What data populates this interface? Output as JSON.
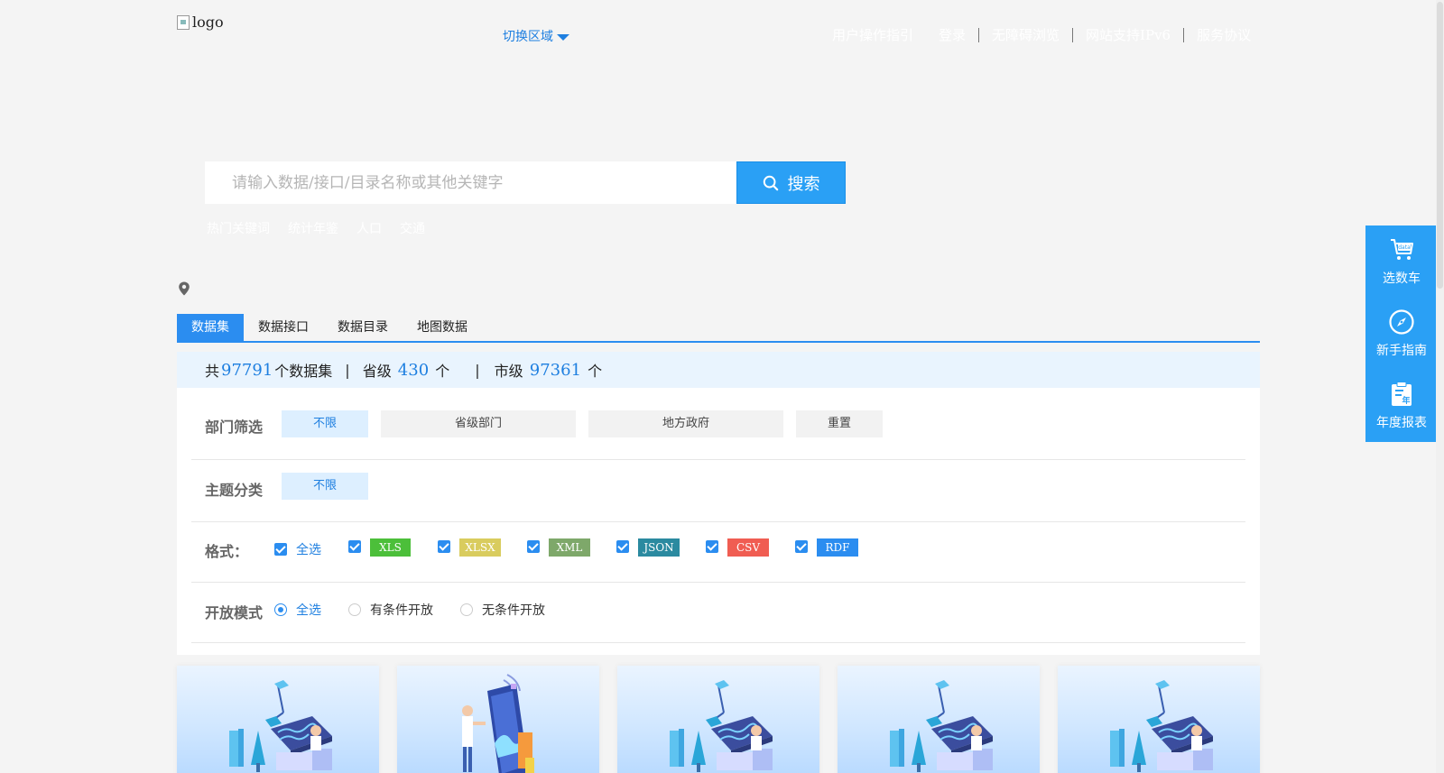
{
  "header": {
    "logo_alt": "logo",
    "region_label": "切换区域",
    "nav": [
      "用户操作指引",
      "登录",
      "无障碍浏览",
      "网站支持IPv6",
      "服务协议"
    ]
  },
  "search": {
    "placeholder": "请输入数据/接口/目录名称或其他关键字",
    "button_label": "搜索",
    "hot_words": [
      "热门关键词",
      "统计年鉴",
      "人口",
      "交通"
    ]
  },
  "tabs": [
    {
      "label": "数据集",
      "active": true
    },
    {
      "label": "数据接口",
      "active": false
    },
    {
      "label": "数据目录",
      "active": false
    },
    {
      "label": "地图数据",
      "active": false
    }
  ],
  "counts": {
    "prefix": "共",
    "total": "97791",
    "total_suffix": "个数据集",
    "sep": "|",
    "province_label": "省级",
    "province": "430",
    "unit": "个",
    "city_label": "市级",
    "city": "97361"
  },
  "filters": {
    "dept": {
      "label": "部门筛选",
      "options": [
        "不限",
        "省级部门",
        "地方政府",
        "重置"
      ]
    },
    "topic": {
      "label": "主题分类",
      "options": [
        "不限"
      ]
    },
    "format": {
      "label": "格式：",
      "all_label": "全选",
      "items": [
        {
          "label": "XLS",
          "color": "#4cbf3a"
        },
        {
          "label": "XLSX",
          "color": "#d9cc5e"
        },
        {
          "label": "XML",
          "color": "#7ea86a"
        },
        {
          "label": "JSON",
          "color": "#2b8aa0"
        },
        {
          "label": "CSV",
          "color": "#f05d52"
        },
        {
          "label": "RDF",
          "color": "#2b8df0"
        }
      ]
    },
    "open_mode": {
      "label": "开放模式",
      "options": [
        {
          "label": "全选",
          "selected": true
        },
        {
          "label": "有条件开放",
          "selected": false
        },
        {
          "label": "无条件开放",
          "selected": false
        }
      ]
    }
  },
  "float_bar": {
    "items": [
      {
        "label": "选数车",
        "icon": "cart-icon"
      },
      {
        "label": "新手指南",
        "icon": "compass-icon"
      },
      {
        "label": "年度报表",
        "icon": "report-icon"
      }
    ],
    "cart_badge": "data",
    "report_badge": "年"
  },
  "colors": {
    "accent": "#2b8df0",
    "search_button": "#2aa0f5",
    "count_bar_bg": "#e9f4fe"
  }
}
